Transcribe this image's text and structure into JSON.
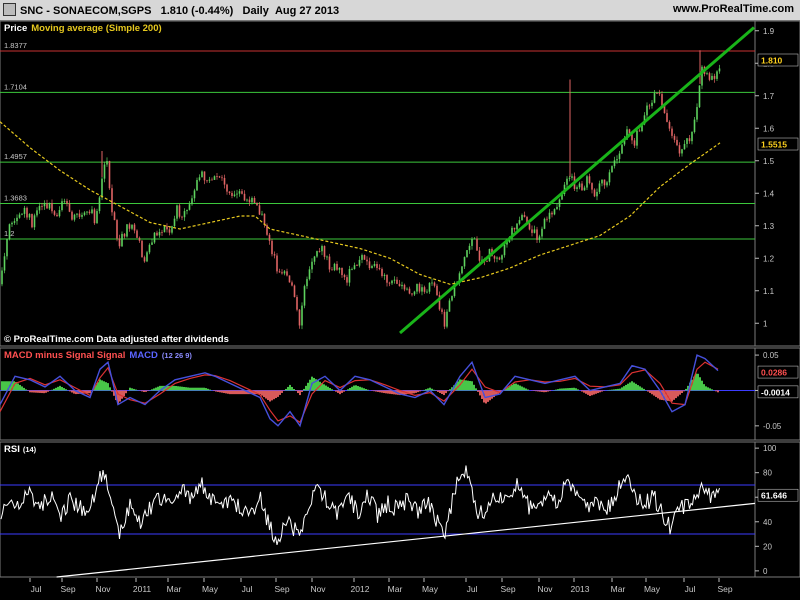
{
  "header": {
    "symbol": "SNC - SONAECOM,SGPS",
    "last": "1.810 (-0.44%)",
    "period": "Daily",
    "date": "Aug 27 2013",
    "site": "www.ProRealTime.com"
  },
  "chart_data": [
    {
      "type": "line",
      "panel": "price",
      "title_price": "Price",
      "title_ma": "Moving average (Simple 200)",
      "ylim": [
        0.93,
        1.93
      ],
      "y_ticks": [
        1.9,
        1.8,
        1.7,
        1.6,
        1.5,
        1.4,
        1.3,
        1.2,
        1.1,
        1
      ],
      "y_tick_labels": [
        "1.9",
        "1.8",
        "1.7",
        "1.6",
        "1.5",
        "1.4",
        "1.3",
        "1.2",
        "1.1",
        "1"
      ],
      "levels": [
        {
          "value": 1.8377,
          "label": "1.8377",
          "color": "#c83232"
        },
        {
          "value": 1.7104,
          "label": "1.7104",
          "color": "#3cc83c"
        },
        {
          "value": 1.4957,
          "label": "1.4957",
          "color": "#3cc83c"
        },
        {
          "value": 1.3683,
          "label": "1.3683",
          "color": "#3cc83c"
        },
        {
          "value": 1.2593,
          "label": "1.2",
          "color": "#3cc83c"
        }
      ],
      "last_price": {
        "value": 1.81,
        "label": "1.810"
      },
      "ma_value": {
        "value": 1.5515,
        "label": "1.5515"
      },
      "price_series": [
        [
          0,
          1.12
        ],
        [
          8,
          1.28
        ],
        [
          16,
          1.33
        ],
        [
          24,
          1.36
        ],
        [
          32,
          1.3
        ],
        [
          40,
          1.35
        ],
        [
          48,
          1.37
        ],
        [
          56,
          1.33
        ],
        [
          64,
          1.37
        ],
        [
          72,
          1.32
        ],
        [
          80,
          1.33
        ],
        [
          88,
          1.36
        ],
        [
          96,
          1.31
        ],
        [
          102,
          1.45
        ],
        [
          106,
          1.52
        ],
        [
          112,
          1.34
        ],
        [
          120,
          1.24
        ],
        [
          128,
          1.31
        ],
        [
          136,
          1.27
        ],
        [
          144,
          1.2
        ],
        [
          152,
          1.25
        ],
        [
          160,
          1.3
        ],
        [
          168,
          1.27
        ],
        [
          176,
          1.35
        ],
        [
          184,
          1.33
        ],
        [
          192,
          1.38
        ],
        [
          200,
          1.46
        ],
        [
          208,
          1.43
        ],
        [
          214,
          1.47
        ],
        [
          222,
          1.43
        ],
        [
          230,
          1.39
        ],
        [
          238,
          1.41
        ],
        [
          246,
          1.37
        ],
        [
          254,
          1.39
        ],
        [
          262,
          1.33
        ],
        [
          270,
          1.25
        ],
        [
          278,
          1.16
        ],
        [
          286,
          1.15
        ],
        [
          294,
          1.1
        ],
        [
          300,
          1.0
        ],
        [
          306,
          1.14
        ],
        [
          314,
          1.22
        ],
        [
          322,
          1.24
        ],
        [
          330,
          1.16
        ],
        [
          338,
          1.18
        ],
        [
          346,
          1.13
        ],
        [
          354,
          1.18
        ],
        [
          362,
          1.2
        ],
        [
          370,
          1.18
        ],
        [
          378,
          1.16
        ],
        [
          386,
          1.14
        ],
        [
          394,
          1.12
        ],
        [
          402,
          1.11
        ],
        [
          410,
          1.1
        ],
        [
          418,
          1.11
        ],
        [
          426,
          1.1
        ],
        [
          434,
          1.12
        ],
        [
          440,
          1.05
        ],
        [
          444,
          0.99
        ],
        [
          450,
          1.08
        ],
        [
          458,
          1.14
        ],
        [
          466,
          1.2
        ],
        [
          474,
          1.26
        ],
        [
          482,
          1.18
        ],
        [
          490,
          1.22
        ],
        [
          498,
          1.2
        ],
        [
          506,
          1.24
        ],
        [
          514,
          1.3
        ],
        [
          522,
          1.32
        ],
        [
          530,
          1.3
        ],
        [
          538,
          1.27
        ],
        [
          546,
          1.33
        ],
        [
          554,
          1.35
        ],
        [
          562,
          1.39
        ],
        [
          570,
          1.45
        ],
        [
          578,
          1.41
        ],
        [
          586,
          1.44
        ],
        [
          594,
          1.4
        ],
        [
          602,
          1.43
        ],
        [
          610,
          1.46
        ],
        [
          618,
          1.51
        ],
        [
          626,
          1.59
        ],
        [
          634,
          1.56
        ],
        [
          642,
          1.61
        ],
        [
          650,
          1.69
        ],
        [
          658,
          1.71
        ],
        [
          664,
          1.65
        ],
        [
          672,
          1.59
        ],
        [
          680,
          1.52
        ],
        [
          688,
          1.56
        ],
        [
          696,
          1.63
        ],
        [
          702,
          1.79
        ],
        [
          710,
          1.75
        ],
        [
          718,
          1.78
        ],
        [
          722,
          1.81
        ]
      ],
      "ma_series": [
        [
          0,
          1.62
        ],
        [
          30,
          1.54
        ],
        [
          60,
          1.47
        ],
        [
          90,
          1.41
        ],
        [
          120,
          1.36
        ],
        [
          150,
          1.31
        ],
        [
          180,
          1.29
        ],
        [
          210,
          1.31
        ],
        [
          240,
          1.33
        ],
        [
          255,
          1.33
        ],
        [
          270,
          1.29
        ],
        [
          300,
          1.27
        ],
        [
          330,
          1.25
        ],
        [
          360,
          1.23
        ],
        [
          390,
          1.2
        ],
        [
          420,
          1.15
        ],
        [
          440,
          1.13
        ],
        [
          450,
          1.12
        ],
        [
          480,
          1.14
        ],
        [
          510,
          1.17
        ],
        [
          540,
          1.21
        ],
        [
          570,
          1.24
        ],
        [
          600,
          1.27
        ],
        [
          630,
          1.33
        ],
        [
          660,
          1.42
        ],
        [
          690,
          1.49
        ],
        [
          720,
          1.555
        ]
      ],
      "trendline": [
        [
          400,
          0.97
        ],
        [
          754,
          1.91
        ]
      ],
      "footer": "© ProRealTime.com  Data adjusted after dividends"
    },
    {
      "type": "bar",
      "panel": "macd",
      "title_hist": "MACD minus Signal Signal",
      "title_macd": "MACD",
      "params": "(12 26 9)",
      "ylim": [
        -0.07,
        0.06
      ],
      "y_ticks": [
        0.05,
        0,
        -0.05
      ],
      "y_tick_labels": [
        "0.05",
        "0",
        "-0.05"
      ],
      "macd_value": {
        "value": 0.0286,
        "label": "0.0286"
      },
      "hist_value": {
        "value": -0.0014,
        "label": "-0.0014"
      },
      "macd_series": [
        [
          0,
          -0.02
        ],
        [
          15,
          0.02
        ],
        [
          30,
          0.015
        ],
        [
          45,
          0.005
        ],
        [
          60,
          0.02
        ],
        [
          75,
          0.0
        ],
        [
          90,
          -0.01
        ],
        [
          100,
          0.03
        ],
        [
          108,
          0.04
        ],
        [
          118,
          -0.02
        ],
        [
          130,
          -0.01
        ],
        [
          145,
          -0.02
        ],
        [
          160,
          0.0
        ],
        [
          175,
          0.015
        ],
        [
          190,
          0.02
        ],
        [
          205,
          0.025
        ],
        [
          215,
          0.02
        ],
        [
          230,
          0.01
        ],
        [
          245,
          0.0
        ],
        [
          260,
          -0.01
        ],
        [
          270,
          -0.04
        ],
        [
          278,
          -0.05
        ],
        [
          290,
          -0.03
        ],
        [
          300,
          -0.05
        ],
        [
          312,
          0.01
        ],
        [
          325,
          0.02
        ],
        [
          340,
          0.0
        ],
        [
          355,
          0.02
        ],
        [
          370,
          0.015
        ],
        [
          385,
          0.005
        ],
        [
          400,
          -0.005
        ],
        [
          415,
          -0.01
        ],
        [
          430,
          0.0
        ],
        [
          444,
          -0.02
        ],
        [
          460,
          0.02
        ],
        [
          472,
          0.04
        ],
        [
          485,
          -0.01
        ],
        [
          500,
          -0.005
        ],
        [
          515,
          0.02
        ],
        [
          530,
          0.015
        ],
        [
          545,
          0.01
        ],
        [
          560,
          0.015
        ],
        [
          575,
          0.02
        ],
        [
          590,
          0.0
        ],
        [
          605,
          0.005
        ],
        [
          620,
          0.01
        ],
        [
          632,
          0.035
        ],
        [
          645,
          0.03
        ],
        [
          660,
          0.0
        ],
        [
          672,
          -0.03
        ],
        [
          685,
          -0.02
        ],
        [
          697,
          0.05
        ],
        [
          705,
          0.045
        ],
        [
          718,
          0.028
        ]
      ],
      "signal_series": [
        [
          0,
          -0.03
        ],
        [
          15,
          0.01
        ],
        [
          30,
          0.017
        ],
        [
          45,
          0.008
        ],
        [
          60,
          0.015
        ],
        [
          75,
          0.004
        ],
        [
          90,
          -0.007
        ],
        [
          100,
          0.018
        ],
        [
          108,
          0.032
        ],
        [
          118,
          -0.005
        ],
        [
          130,
          -0.013
        ],
        [
          145,
          -0.018
        ],
        [
          160,
          -0.005
        ],
        [
          175,
          0.01
        ],
        [
          190,
          0.017
        ],
        [
          205,
          0.022
        ],
        [
          215,
          0.021
        ],
        [
          230,
          0.014
        ],
        [
          245,
          0.004
        ],
        [
          260,
          -0.006
        ],
        [
          270,
          -0.028
        ],
        [
          278,
          -0.043
        ],
        [
          290,
          -0.036
        ],
        [
          300,
          -0.045
        ],
        [
          312,
          -0.005
        ],
        [
          325,
          0.014
        ],
        [
          340,
          0.004
        ],
        [
          355,
          0.014
        ],
        [
          370,
          0.015
        ],
        [
          385,
          0.008
        ],
        [
          400,
          0.0
        ],
        [
          415,
          -0.007
        ],
        [
          430,
          -0.003
        ],
        [
          444,
          -0.015
        ],
        [
          460,
          0.008
        ],
        [
          472,
          0.03
        ],
        [
          485,
          0.005
        ],
        [
          500,
          -0.003
        ],
        [
          515,
          0.012
        ],
        [
          530,
          0.015
        ],
        [
          545,
          0.012
        ],
        [
          560,
          0.013
        ],
        [
          575,
          0.017
        ],
        [
          590,
          0.006
        ],
        [
          605,
          0.005
        ],
        [
          620,
          0.008
        ],
        [
          632,
          0.025
        ],
        [
          645,
          0.029
        ],
        [
          660,
          0.01
        ],
        [
          672,
          -0.018
        ],
        [
          685,
          -0.02
        ],
        [
          697,
          0.03
        ],
        [
          705,
          0.04
        ],
        [
          718,
          0.03
        ]
      ]
    },
    {
      "type": "line",
      "panel": "rsi",
      "title": "RSI",
      "params": "(14)",
      "ylim": [
        -5,
        105
      ],
      "y_ticks": [
        100,
        80,
        60,
        40,
        20,
        0
      ],
      "y_tick_labels": [
        "100",
        "80",
        "60",
        "40",
        "20",
        "0"
      ],
      "levels": [
        70,
        30
      ],
      "rsi_value": {
        "value": 61.646,
        "label": "61.646"
      },
      "rsi_series": [
        [
          0,
          45
        ],
        [
          10,
          60
        ],
        [
          20,
          55
        ],
        [
          30,
          65
        ],
        [
          40,
          50
        ],
        [
          50,
          62
        ],
        [
          60,
          45
        ],
        [
          70,
          58
        ],
        [
          80,
          52
        ],
        [
          90,
          48
        ],
        [
          100,
          78
        ],
        [
          104,
          80
        ],
        [
          112,
          50
        ],
        [
          120,
          30
        ],
        [
          130,
          55
        ],
        [
          140,
          40
        ],
        [
          150,
          50
        ],
        [
          160,
          60
        ],
        [
          170,
          55
        ],
        [
          180,
          68
        ],
        [
          190,
          60
        ],
        [
          200,
          72
        ],
        [
          210,
          62
        ],
        [
          220,
          48
        ],
        [
          230,
          58
        ],
        [
          240,
          52
        ],
        [
          250,
          45
        ],
        [
          260,
          60
        ],
        [
          270,
          35
        ],
        [
          278,
          25
        ],
        [
          288,
          40
        ],
        [
          298,
          30
        ],
        [
          308,
          48
        ],
        [
          318,
          70
        ],
        [
          328,
          55
        ],
        [
          338,
          45
        ],
        [
          348,
          60
        ],
        [
          358,
          48
        ],
        [
          368,
          62
        ],
        [
          378,
          45
        ],
        [
          388,
          55
        ],
        [
          398,
          50
        ],
        [
          408,
          58
        ],
        [
          418,
          48
        ],
        [
          428,
          55
        ],
        [
          438,
          40
        ],
        [
          444,
          30
        ],
        [
          452,
          55
        ],
        [
          460,
          80
        ],
        [
          468,
          82
        ],
        [
          476,
          50
        ],
        [
          486,
          45
        ],
        [
          496,
          62
        ],
        [
          506,
          55
        ],
        [
          516,
          70
        ],
        [
          526,
          55
        ],
        [
          536,
          48
        ],
        [
          546,
          62
        ],
        [
          556,
          55
        ],
        [
          566,
          70
        ],
        [
          576,
          62
        ],
        [
          586,
          50
        ],
        [
          596,
          55
        ],
        [
          606,
          48
        ],
        [
          616,
          62
        ],
        [
          624,
          80
        ],
        [
          634,
          60
        ],
        [
          644,
          55
        ],
        [
          654,
          60
        ],
        [
          664,
          45
        ],
        [
          670,
          35
        ],
        [
          680,
          50
        ],
        [
          690,
          55
        ],
        [
          700,
          68
        ],
        [
          710,
          62
        ],
        [
          718,
          65
        ]
      ],
      "trendline": [
        [
          60,
          -5
        ],
        [
          800,
          55
        ]
      ]
    }
  ],
  "x_axis": {
    "labels": [
      {
        "x": 36,
        "label": "Jul"
      },
      {
        "x": 68,
        "label": "Sep"
      },
      {
        "x": 103,
        "label": "Nov"
      },
      {
        "x": 142,
        "label": "2011"
      },
      {
        "x": 174,
        "label": "Mar"
      },
      {
        "x": 210,
        "label": "May"
      },
      {
        "x": 247,
        "label": "Jul"
      },
      {
        "x": 282,
        "label": "Sep"
      },
      {
        "x": 318,
        "label": "Nov"
      },
      {
        "x": 360,
        "label": "2012"
      },
      {
        "x": 395,
        "label": "Mar"
      },
      {
        "x": 430,
        "label": "May"
      },
      {
        "x": 472,
        "label": "Jul"
      },
      {
        "x": 508,
        "label": "Sep"
      },
      {
        "x": 545,
        "label": "Nov"
      },
      {
        "x": 580,
        "label": "2013"
      },
      {
        "x": 618,
        "label": "Mar"
      },
      {
        "x": 652,
        "label": "May"
      },
      {
        "x": 690,
        "label": "Jul"
      },
      {
        "x": 725,
        "label": "Sep"
      }
    ]
  },
  "colors": {
    "up": "#5ed25e",
    "down": "#e06464",
    "ma": "#e6c81e",
    "trend": "#19b419",
    "macd": "#4650dc",
    "signal": "#dc3232",
    "hist_up": "#50dc50",
    "hist_down": "#f06464",
    "rsi": "#ffffff",
    "rsi_band": "#3c3cff"
  }
}
